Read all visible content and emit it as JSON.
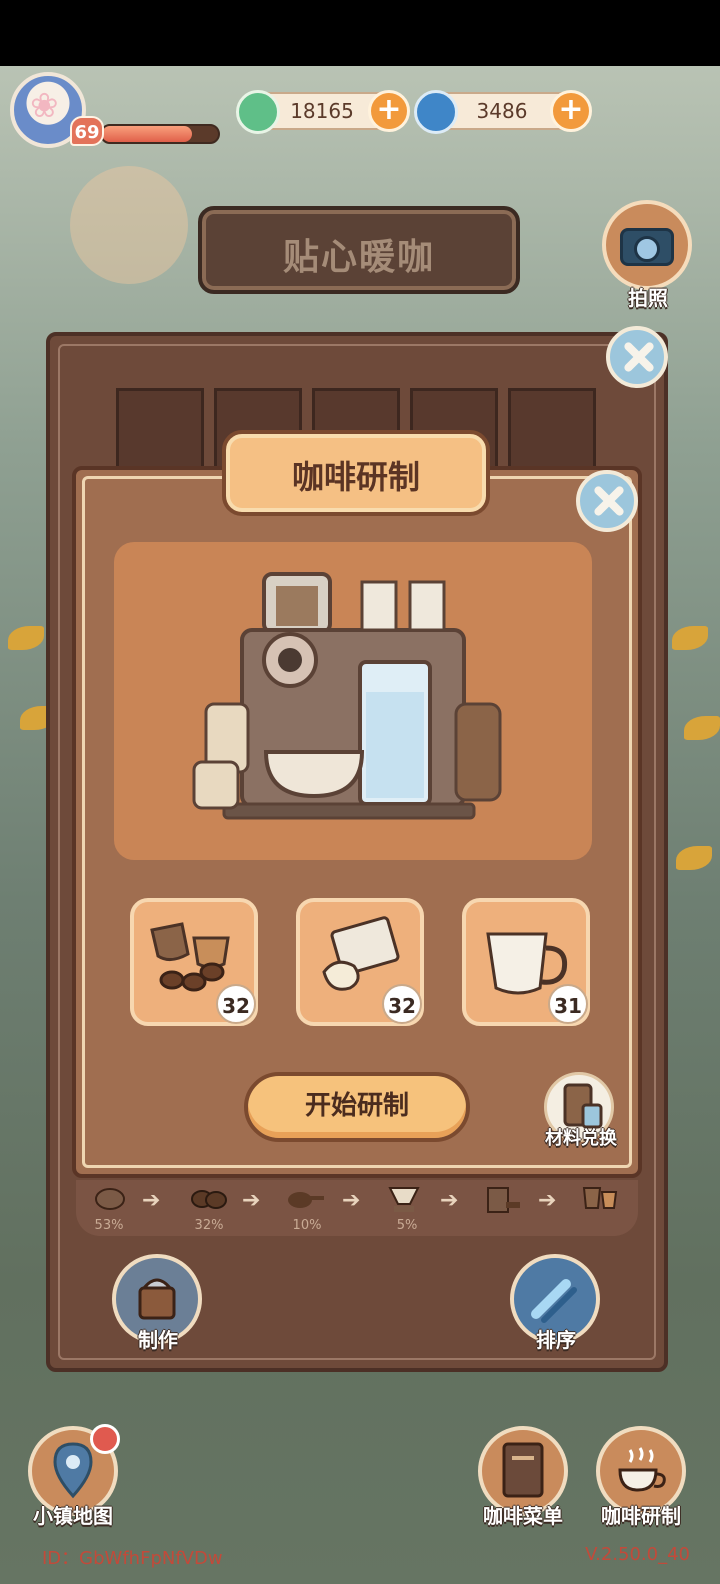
{
  "player": {
    "level": "69",
    "xp_fraction": 0.78
  },
  "currency": {
    "mint": {
      "value": "18165",
      "icon": "mint-leaf-icon"
    },
    "swirl": {
      "value": "3486",
      "icon": "blue-swirl-icon"
    }
  },
  "location_title": "贴心暖咖",
  "camera": {
    "label": "拍照"
  },
  "modal": {
    "title": "咖啡研制",
    "ingredients": [
      {
        "name": "coffee-cups-beans",
        "count": "32"
      },
      {
        "name": "sugar-packet",
        "count": "32"
      },
      {
        "name": "milk-pitcher",
        "count": "31"
      }
    ],
    "start_label": "开始研制",
    "exchange_label": "材料兑换"
  },
  "process": {
    "percents": [
      "53%",
      "32%",
      "10%",
      "5%"
    ]
  },
  "actions": {
    "make_label": "制作",
    "sort_label": "排序"
  },
  "bottom_nav": {
    "map": "小镇地图",
    "menu": "咖啡菜单",
    "research": "咖啡研制"
  },
  "footer": {
    "id": "ID：GbWfhFpNfVDw",
    "version": "V.2.50.0_40"
  },
  "colors": {
    "accent": "#f29a3c",
    "panel": "#a06e50",
    "title_sign": "#5b4236"
  }
}
